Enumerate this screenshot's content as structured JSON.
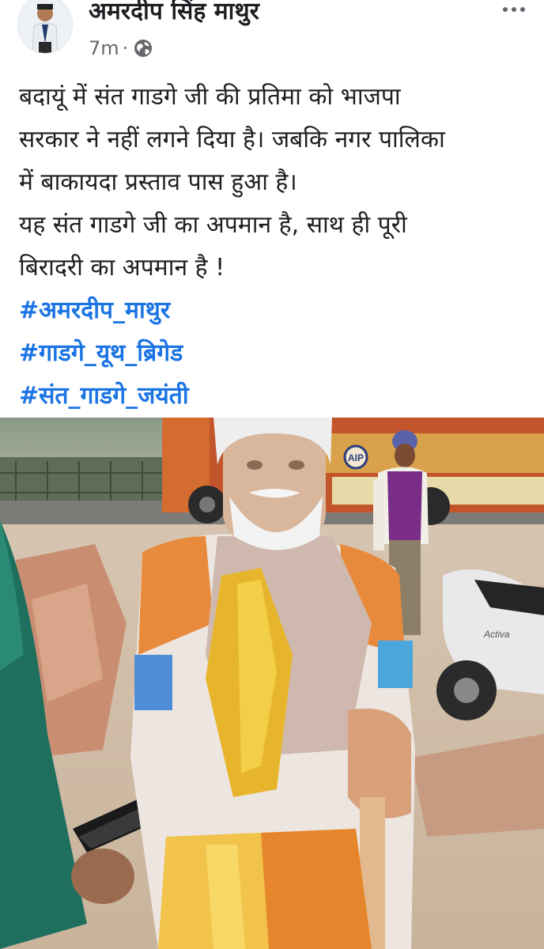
{
  "post": {
    "author_name": "अमरदीप सिंह माथुर",
    "time": "7m",
    "separator": "·",
    "privacy_icon": "globe-icon",
    "more_icon": "more-horizontal-icon",
    "body_lines": [
      "बदायूं में संत गाडगे जी की प्रतिमा को भाजपा",
      "सरकार ने नहीं लगने दिया है। जबकि नगर पालिका",
      "में बाकायदा प्रस्ताव पास हुआ है।",
      "यह संत गाडगे जी का अपमान है, साथ ही पूरी",
      "बिरादरी का अपमान है !"
    ],
    "hashtags": [
      "#अमरदीप_माथुर",
      "#गाडगे_यूथ_ब्रिगेड",
      "#संत_गाडगे_जयंती"
    ],
    "truck_plate_text": "AIP",
    "scooter_badge": "Activa"
  },
  "colors": {
    "text": "#1c1e21",
    "secondary_text": "#65676b",
    "hashtag": "#1b74e4"
  }
}
